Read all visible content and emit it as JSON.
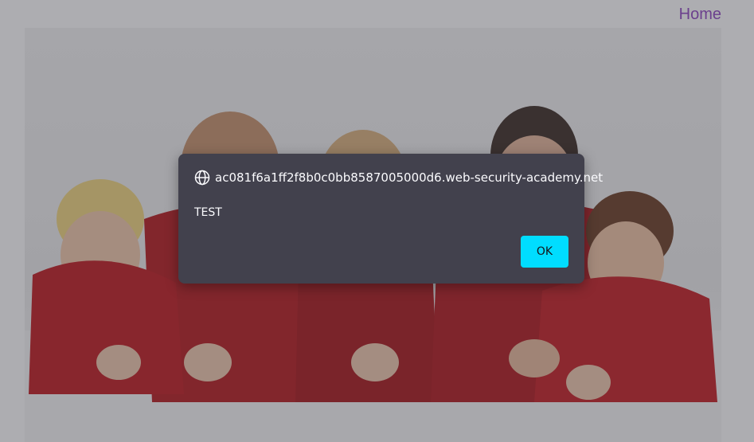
{
  "nav": {
    "home_label": "Home"
  },
  "dialog": {
    "origin": "ac081f6a1ff2f8b0c0bb8587005000d6.web-security-academy.net",
    "message": "TEST",
    "ok_label": "OK",
    "icon": "globe-icon"
  },
  "hero_image": {
    "subject": "family-photo"
  },
  "colors": {
    "link": "#8e44c2",
    "dialog_bg": "#42414d",
    "ok_button_bg": "#00ddff",
    "overlay": "rgba(60,60,70,0.42)"
  }
}
